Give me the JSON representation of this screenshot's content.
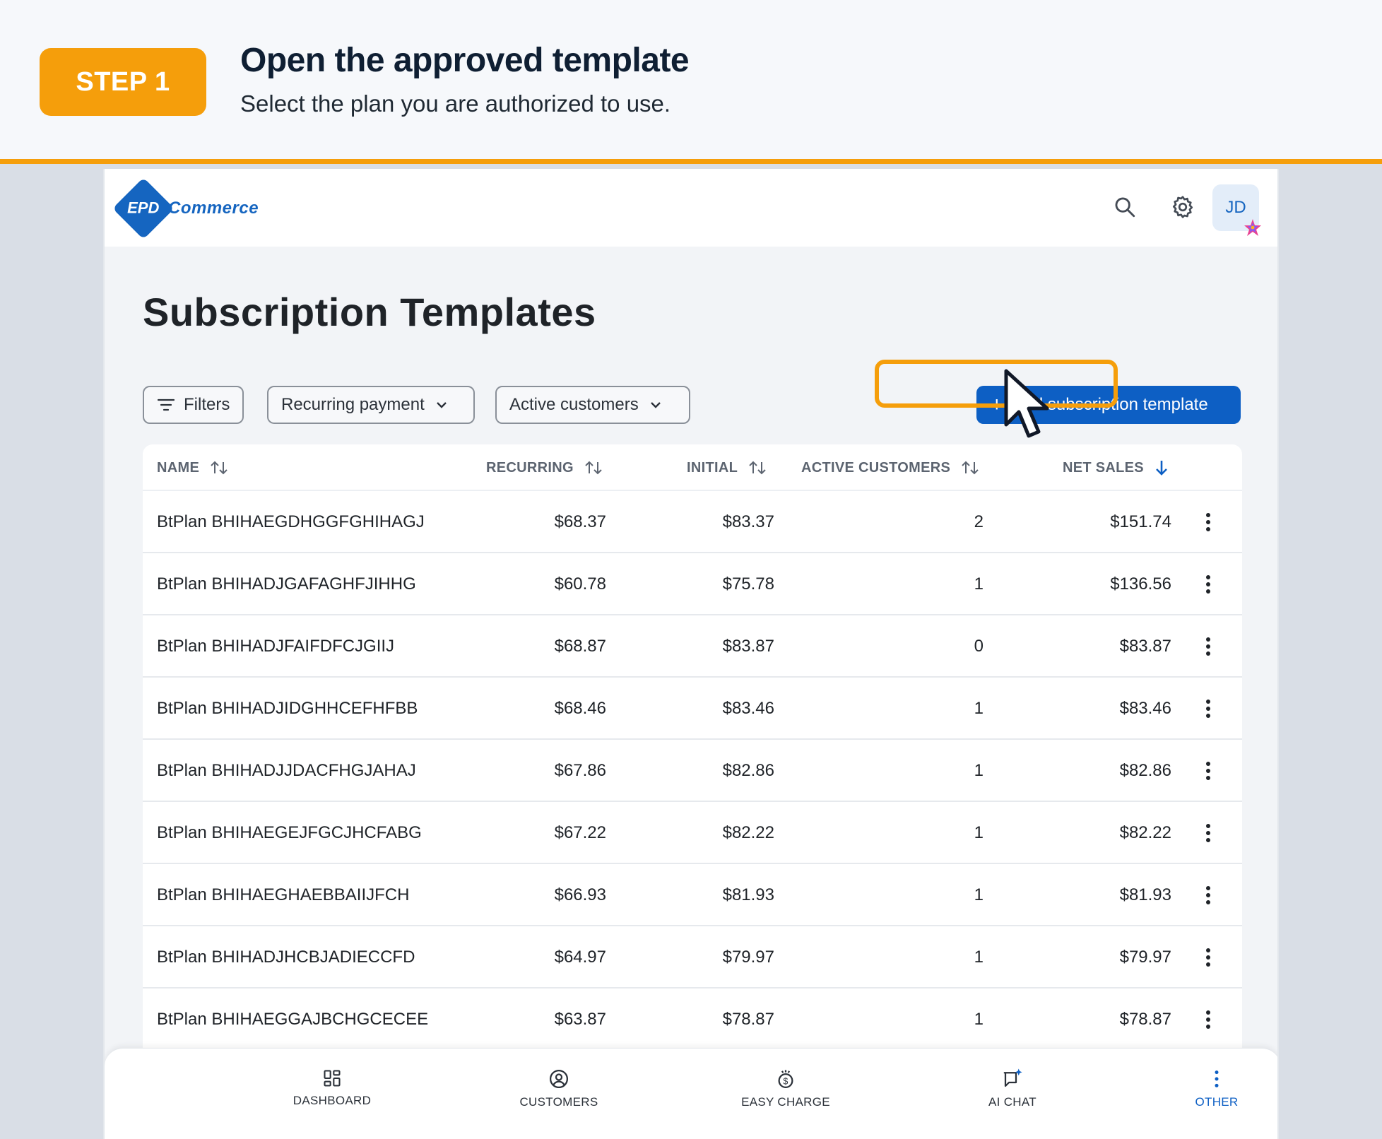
{
  "banner": {
    "step_label": "STEP 1",
    "title": "Open the approved template",
    "subtitle": "Select the plan you are authorized to use."
  },
  "header": {
    "logo_left": "EPD",
    "logo_right": "Commerce",
    "avatar_initials": "JD"
  },
  "page": {
    "title": "Subscription Templates"
  },
  "filters": {
    "filters_label": "Filters",
    "payment_type": "Recurring payment",
    "customer_scope": "Active customers"
  },
  "actions": {
    "add_template": "Add subscription template"
  },
  "table": {
    "columns": {
      "name": "NAME",
      "recurring": "RECURRING",
      "initial": "INITIAL",
      "active_customers": "ACTIVE CUSTOMERS",
      "net_sales": "NET SALES"
    },
    "rows": [
      {
        "name": "BtPlan BHIHAEGDHGGFGHIHAGJ",
        "recurring": "$68.37",
        "initial": "$83.37",
        "active": "2",
        "net": "$151.74"
      },
      {
        "name": "BtPlan BHIHADJGAFAGHFJIHHG",
        "recurring": "$60.78",
        "initial": "$75.78",
        "active": "1",
        "net": "$136.56"
      },
      {
        "name": "BtPlan BHIHADJFAIFDFCJGIIJ",
        "recurring": "$68.87",
        "initial": "$83.87",
        "active": "0",
        "net": "$83.87"
      },
      {
        "name": "BtPlan BHIHADJIDGHHCEFHFBB",
        "recurring": "$68.46",
        "initial": "$83.46",
        "active": "1",
        "net": "$83.46"
      },
      {
        "name": "BtPlan BHIHADJJDACFHGJAHAJ",
        "recurring": "$67.86",
        "initial": "$82.86",
        "active": "1",
        "net": "$82.86"
      },
      {
        "name": "BtPlan BHIHAEGEJFGCJHCFABG",
        "recurring": "$67.22",
        "initial": "$82.22",
        "active": "1",
        "net": "$82.22"
      },
      {
        "name": "BtPlan BHIHAEGHAEBBAIIJFCH",
        "recurring": "$66.93",
        "initial": "$81.93",
        "active": "1",
        "net": "$81.93"
      },
      {
        "name": "BtPlan BHIHADJHCBJADIECCFD",
        "recurring": "$64.97",
        "initial": "$79.97",
        "active": "1",
        "net": "$79.97"
      },
      {
        "name": "BtPlan BHIHAEGGAJBCHGCECEE",
        "recurring": "$63.87",
        "initial": "$78.87",
        "active": "1",
        "net": "$78.87"
      }
    ]
  },
  "bottom_nav": {
    "items": [
      {
        "label": "DASHBOARD",
        "icon": "dashboard-icon"
      },
      {
        "label": "CUSTOMERS",
        "icon": "customers-icon"
      },
      {
        "label": "EASY CHARGE",
        "icon": "easy-charge-icon"
      },
      {
        "label": "AI CHAT",
        "icon": "ai-chat-icon"
      },
      {
        "label": "OTHER",
        "icon": "more-vertical-icon"
      }
    ],
    "active": "OTHER"
  },
  "colors": {
    "accent": "#f59e0b",
    "primary": "#0d5fc4",
    "background": "#f2f4f7"
  }
}
